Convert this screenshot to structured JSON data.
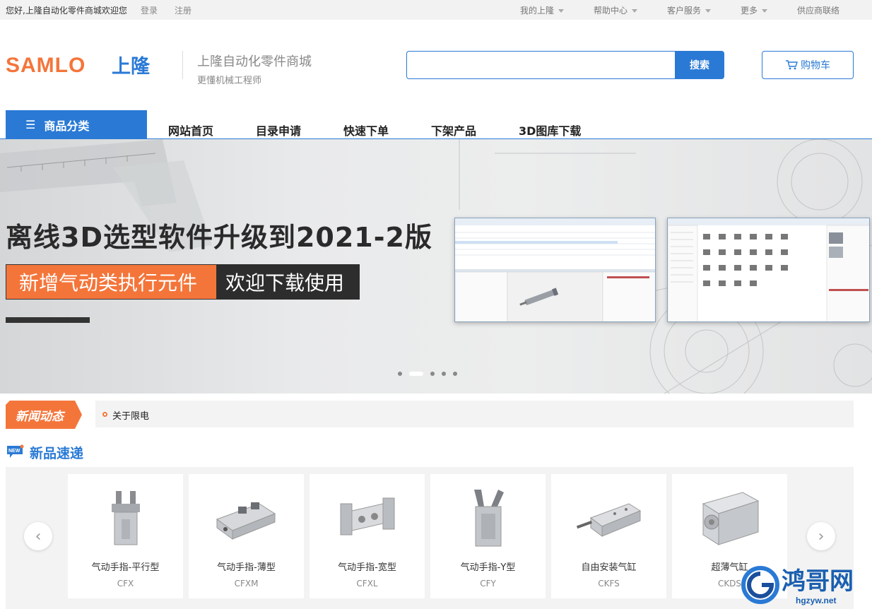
{
  "topbar": {
    "welcome": "您好,上隆自动化零件商城欢迎您",
    "login": "登录",
    "register": "注册",
    "menus": [
      "我的上隆",
      "帮助中心",
      "客户服务",
      "更多"
    ],
    "supplier": "供应商联络"
  },
  "header": {
    "logo_text": "SAMLO上隆",
    "site_title": "上隆自动化零件商城",
    "site_subtitle": "更懂机械工程师",
    "search_value": "",
    "search_button": "搜索",
    "cart_button": "购物车"
  },
  "nav": {
    "category": "商品分类",
    "items": [
      "网站首页",
      "目录申请",
      "快速下单",
      "下架产品",
      "3D图库下载"
    ]
  },
  "banner": {
    "title": "离线3D选型软件升级到2021-2版",
    "tag_orange": "新增气动类执行元件",
    "tag_dark": "欢迎下载使用",
    "dots_total": 5,
    "active_dot": 2
  },
  "news": {
    "label": "新闻动态",
    "item": "关于限电"
  },
  "new_products": {
    "title": "新品速递",
    "badge": "NEW",
    "items": [
      {
        "name": "气动手指-平行型",
        "code": "CFX",
        "icon": "parallel-gripper-icon"
      },
      {
        "name": "气动手指-薄型",
        "code": "CFXM",
        "icon": "thin-gripper-icon"
      },
      {
        "name": "气动手指-宽型",
        "code": "CFXL",
        "icon": "wide-gripper-icon"
      },
      {
        "name": "气动手指-Y型",
        "code": "CFY",
        "icon": "y-gripper-icon"
      },
      {
        "name": "自由安装气缸",
        "code": "CKFS",
        "icon": "free-mount-cylinder-icon"
      },
      {
        "name": "超薄气缸",
        "code": "CKDS",
        "icon": "compact-cylinder-icon"
      }
    ]
  },
  "watermark": {
    "name": "鸿哥网",
    "url": "hgzyw.net"
  },
  "colors": {
    "brand_blue": "#2a7ad5",
    "brand_orange": "#f4753a"
  }
}
